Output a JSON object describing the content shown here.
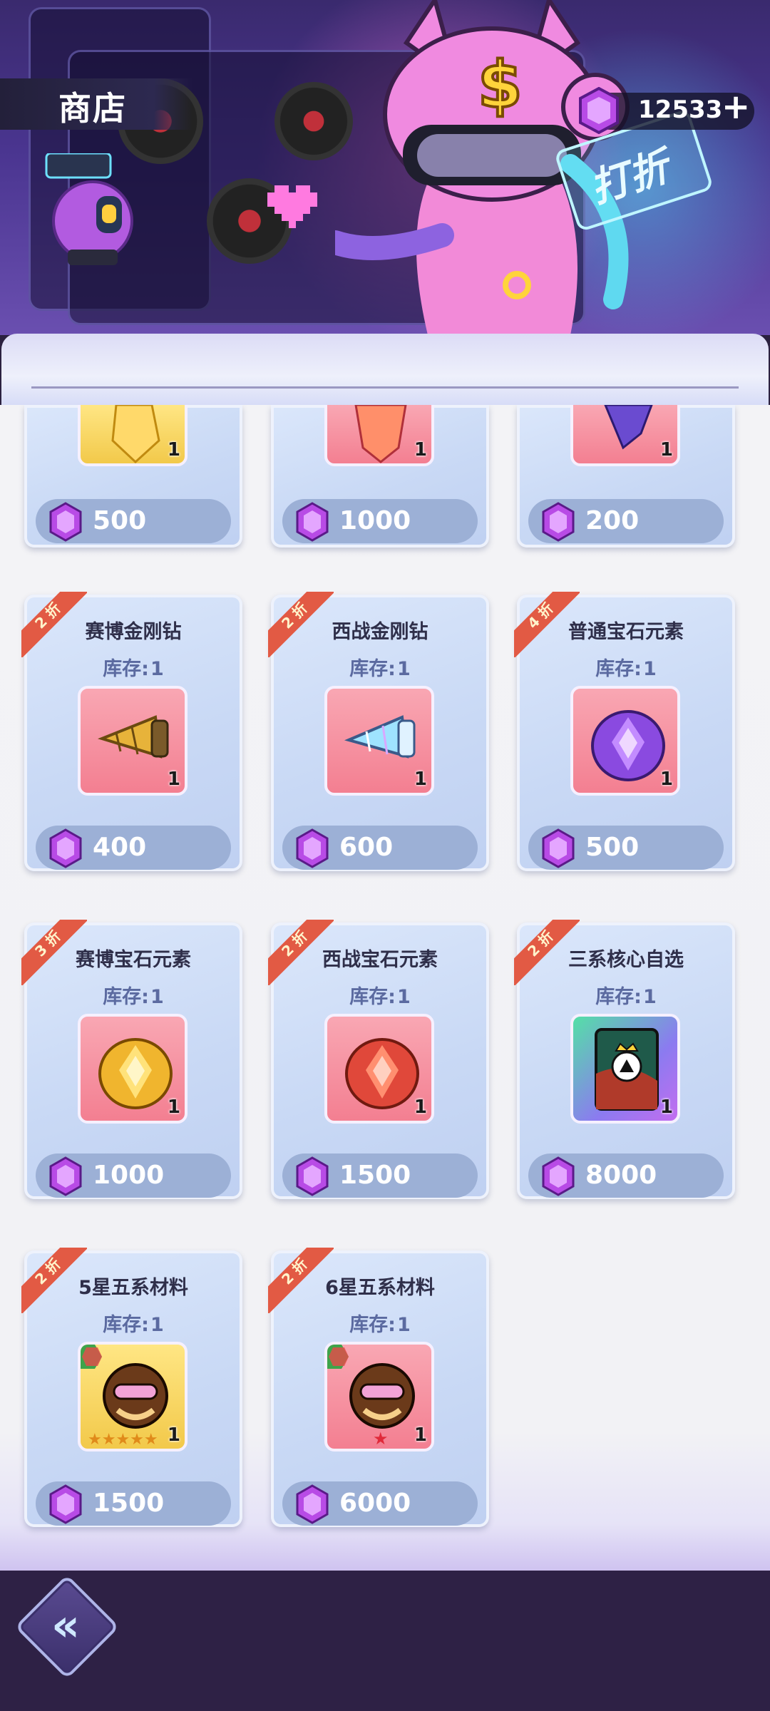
{
  "header": {
    "title": "商店",
    "currency": {
      "value": "12533",
      "plus": "+"
    },
    "banner_sign": "打折"
  },
  "theme": {
    "gem_color": "#a53be0",
    "ribbon_color": "#e25a44",
    "price_bar": "#9cb0d6",
    "footer": "#2e2145"
  },
  "partial_row": [
    {
      "price": "500",
      "qty": "1",
      "item_bg": "gold"
    },
    {
      "price": "1000",
      "qty": "1",
      "item_bg": "pink"
    },
    {
      "price": "200",
      "qty": "1",
      "item_bg": "pink"
    }
  ],
  "stock_label": "库存:",
  "items": [
    {
      "discount": "2 折",
      "name": "赛博金刚钻",
      "stock": "1",
      "qty": "1",
      "price": "400",
      "item_bg": "pink",
      "icon": "gold-drill-icon"
    },
    {
      "discount": "2 折",
      "name": "西战金刚钻",
      "stock": "1",
      "qty": "1",
      "price": "600",
      "item_bg": "pink",
      "icon": "ice-drill-icon"
    },
    {
      "discount": "4 折",
      "name": "普通宝石元素",
      "stock": "1",
      "qty": "1",
      "price": "500",
      "item_bg": "pink",
      "icon": "purple-crystal-icon"
    },
    {
      "discount": "3 折",
      "name": "赛博宝石元素",
      "stock": "1",
      "qty": "1",
      "price": "1000",
      "item_bg": "pink",
      "icon": "gold-crystal-icon"
    },
    {
      "discount": "2 折",
      "name": "西战宝石元素",
      "stock": "1",
      "qty": "1",
      "price": "1500",
      "item_bg": "pink",
      "icon": "red-crystal-icon"
    },
    {
      "discount": "2 折",
      "name": "三系核心自选",
      "stock": "1",
      "qty": "1",
      "price": "8000",
      "item_bg": "green",
      "icon": "core-card-icon"
    },
    {
      "discount": "2 折",
      "name": "5星五系材料",
      "stock": "1",
      "qty": "1",
      "price": "1500",
      "item_bg": "gold",
      "icon": "monkey-5star-icon"
    },
    {
      "discount": "2 折",
      "name": "6星五系材料",
      "stock": "1",
      "qty": "1",
      "price": "6000",
      "item_bg": "pink",
      "icon": "monkey-6star-icon"
    }
  ],
  "footer": {
    "back_icon": "double-chevron-left-icon"
  }
}
